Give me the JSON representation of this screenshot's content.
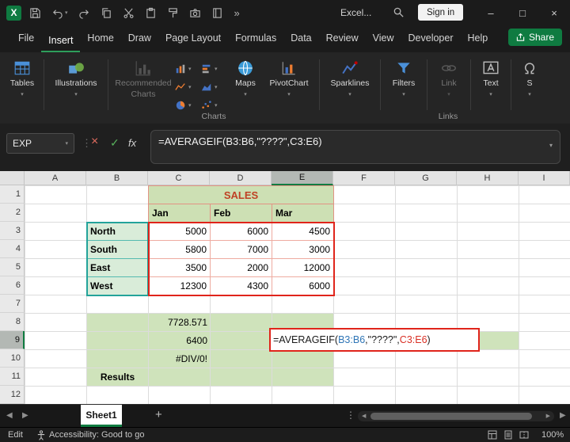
{
  "colors": {
    "accent_green": "#107c41",
    "share_green": "#0f7b41",
    "annotation_red": "#e0241b",
    "range_ref_blue": "#2e75b6",
    "range_ref_red": "#d93025",
    "range_border_teal": "#23a39a",
    "table_header_green": "#cde0b4",
    "results_block_green": "#cfe3bb",
    "sales_text_red": "#bf4024"
  },
  "titlebar": {
    "logo_letter": "X",
    "quick_access_icons": [
      "save",
      "undo",
      "redo",
      "copy",
      "cut",
      "paste",
      "format-painter",
      "camera",
      "notebook"
    ],
    "overflow_glyph": "»",
    "title": "Excel...",
    "search_icon": "magnifier",
    "sign_in_label": "Sign in",
    "window": {
      "minimize": "–",
      "maximize": "□",
      "close": "×"
    }
  },
  "menubar": {
    "tabs": [
      {
        "label": "File"
      },
      {
        "label": "Insert",
        "active": true
      },
      {
        "label": "Home"
      },
      {
        "label": "Draw"
      },
      {
        "label": "Page Layout"
      },
      {
        "label": "Formulas"
      },
      {
        "label": "Data"
      },
      {
        "label": "Review"
      },
      {
        "label": "View"
      },
      {
        "label": "Developer"
      },
      {
        "label": "Help"
      }
    ],
    "share_label": "Share"
  },
  "ribbon": {
    "tables_label": "Tables",
    "illustrations_label": "Illustrations",
    "recommended_charts_line1": "Recommended",
    "recommended_charts_line2": "Charts",
    "chart_mini_icons": [
      "column-chart",
      "bar-chart",
      "line-chart",
      "area-chart",
      "pie-chart",
      "scatter-chart"
    ],
    "maps_label": "Maps",
    "pivotchart_label": "PivotChart",
    "sparklines_label": "Sparklines",
    "filters_label": "Filters",
    "link_label": "Link",
    "text_label": "Text",
    "symbols_label": "S",
    "group_charts_label": "Charts",
    "group_links_label": "Links",
    "chevron_glyph": "▾"
  },
  "formula_bar": {
    "name_box_value": "EXP",
    "separator_glyph": "⋮",
    "cancel_glyph": "×",
    "enter_glyph": "✓",
    "fx_label": "fx",
    "formula": "=AVERAGEIF(B3:B6,\"????\",C3:E6)",
    "expand_glyph": "▾"
  },
  "grid": {
    "columns": [
      "A",
      "B",
      "C",
      "D",
      "E",
      "F",
      "G",
      "H",
      "I"
    ],
    "rows": [
      "1",
      "2",
      "3",
      "4",
      "5",
      "6",
      "7",
      "8",
      "9",
      "10",
      "11",
      "12"
    ],
    "selected_column": "E",
    "selected_row": "9"
  },
  "sheet": {
    "title_cell": "SALES",
    "months": [
      "Jan",
      "Feb",
      "Mar"
    ],
    "regions": [
      "North",
      "South",
      "East",
      "West"
    ],
    "values": [
      [
        "5000",
        "6000",
        "4500"
      ],
      [
        "5800",
        "7000",
        "3000"
      ],
      [
        "3500",
        "2000",
        "12000"
      ],
      [
        "12300",
        "4300",
        "6000"
      ]
    ],
    "result_avg": "7728.571",
    "result_avgif": "6400",
    "result_div0": "#DIV/0!",
    "results_label": "Results",
    "edit_formula_parts": [
      {
        "text": "=AVERAGEIF(",
        "color": "#1a1a1a"
      },
      {
        "text": "B3:B6",
        "color": "#2e75b6"
      },
      {
        "text": ",\"????\",",
        "color": "#1a1a1a"
      },
      {
        "text": "C3:E6",
        "color": "#d93025"
      },
      {
        "text": ")",
        "color": "#1a1a1a"
      }
    ]
  },
  "tabbar": {
    "nav_left": "◀",
    "nav_right": "▶",
    "sheet_name": "Sheet1",
    "add_sheet_glyph": "+",
    "more_glyph": "⋮",
    "scroll_left": "◀",
    "scroll_right": "▶",
    "far_right_arrow": "▶"
  },
  "statusbar": {
    "mode": "Edit",
    "accessibility_text": "Accessibility: Good to go",
    "view_icons": [
      "normal-view",
      "page-layout-view",
      "page-break-preview"
    ],
    "zoom": "100%"
  }
}
